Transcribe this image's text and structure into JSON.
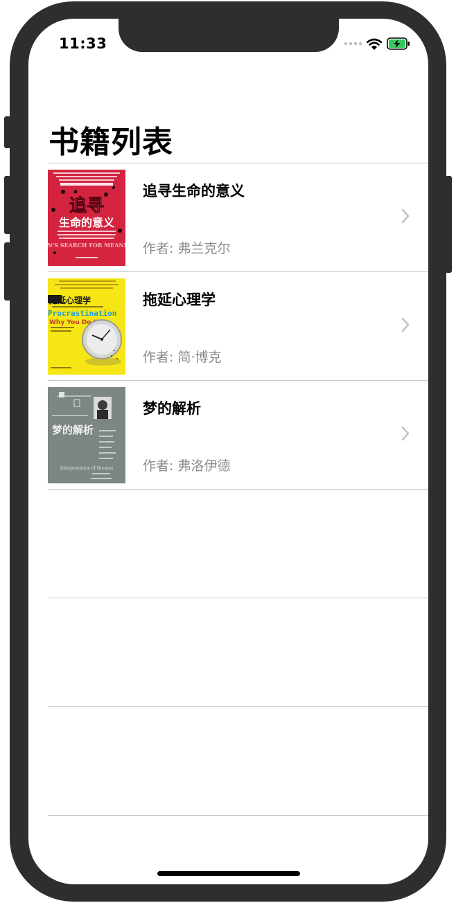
{
  "status_bar": {
    "time": "11:33"
  },
  "navigation": {
    "title": "书籍列表"
  },
  "books": [
    {
      "title": "追寻生命的意义",
      "author": "作者: 弗兰克尔",
      "cover": {
        "main_text": "追寻",
        "sub_text": "生命的意义",
        "english_text": "MAN'S SEARCH FOR MEANING",
        "background_color": "#d4243f"
      }
    },
    {
      "title": "拖延心理学",
      "author": "作者: 简·博克",
      "cover": {
        "main_text": "拖延心理学",
        "english_text": "Procrastination",
        "tagline": "Why You Do It",
        "background_color": "#f6e616"
      }
    },
    {
      "title": "梦的解析",
      "author": "作者: 弗洛伊德",
      "cover": {
        "main_text": "梦的解析",
        "english_text": "Interpretation of Dreams",
        "background_color": "#7c8683"
      }
    }
  ],
  "icons": {
    "disclosure": "chevron-right-icon",
    "wifi": "wifi-icon",
    "battery": "battery-charging-icon"
  },
  "colors": {
    "battery_green": "#34c759",
    "separator": "#c8c8cc",
    "secondary_text": "#8a8a8e",
    "chevron": "#c4c4c7"
  }
}
